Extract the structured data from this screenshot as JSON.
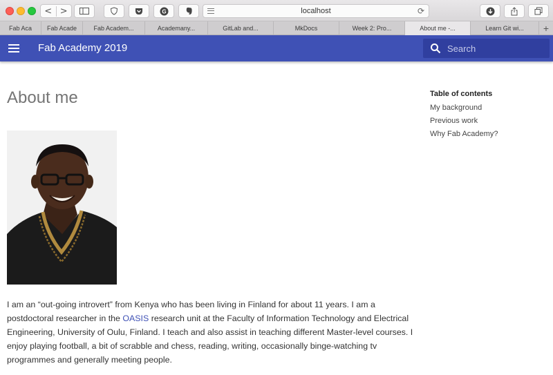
{
  "browser": {
    "url": "localhost",
    "nav_back": "<",
    "nav_forward": ">",
    "reload": "⟳",
    "tabs": [
      {
        "label": "Fab Aca",
        "active": false
      },
      {
        "label": "Fab Acade",
        "active": false
      },
      {
        "label": "Fab Academ...",
        "active": false
      },
      {
        "label": "Academany...",
        "active": false
      },
      {
        "label": "GitLab and...",
        "active": false
      },
      {
        "label": "MkDocs",
        "active": false
      },
      {
        "label": "Week 2: Pro...",
        "active": false
      },
      {
        "label": "About me -...",
        "active": true
      },
      {
        "label": "Learn Git wi...",
        "active": false
      }
    ],
    "new_tab": "+"
  },
  "header": {
    "site_title": "Fab Academy 2019",
    "search_placeholder": "Search"
  },
  "page": {
    "title": "About me",
    "para_before_link": "I am an “out-going introvert” from Kenya who has been living in Finland for about 11 years. I am a postdoctoral researcher in the ",
    "para_link": "OASIS",
    "para_after_link": " research unit at the Faculty of Information Technology and Electrical Engineering, University of Oulu, Finland. I teach and also assist in teaching different Master-level courses. I enjoy playing football, a bit of scrabble and chess, reading, writing, occasionally binge-watching tv programmes and generally meeting people."
  },
  "toc": {
    "title": "Table of contents",
    "items": [
      "My background",
      "Previous work",
      "Why Fab Academy?"
    ]
  },
  "colors": {
    "primary": "#3f51b5",
    "search_bg": "#303f9f"
  }
}
